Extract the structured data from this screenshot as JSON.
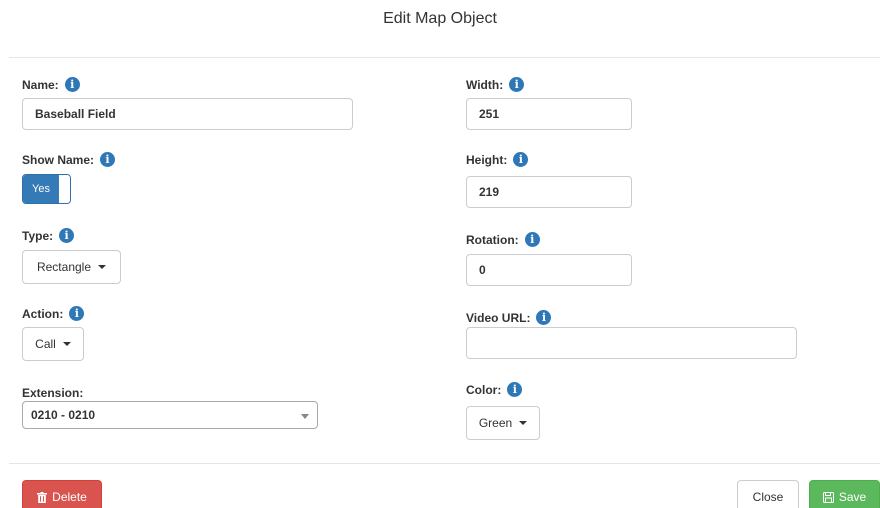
{
  "modal": {
    "title": "Edit Map Object"
  },
  "left": {
    "name": {
      "label": "Name:",
      "value": "Baseball Field"
    },
    "show_name": {
      "label": "Show Name:",
      "toggle_label": "Yes",
      "state": true
    },
    "type": {
      "label": "Type:",
      "value": "Rectangle"
    },
    "action": {
      "label": "Action:",
      "value": "Call"
    },
    "extension": {
      "label": "Extension:",
      "value": "0210 - 0210"
    }
  },
  "right": {
    "width": {
      "label": "Width:",
      "value": "251"
    },
    "height": {
      "label": "Height:",
      "value": "219"
    },
    "rotation": {
      "label": "Rotation:",
      "value": "0"
    },
    "video_url": {
      "label": "Video URL:",
      "value": ""
    },
    "color": {
      "label": "Color:",
      "value": "Green"
    }
  },
  "footer": {
    "delete_label": "Delete",
    "close_label": "Close",
    "save_label": "Save"
  },
  "icons": {
    "info": "info-circle-icon",
    "trash": "trash-icon",
    "save": "floppy-disk-icon"
  },
  "colors": {
    "primary": "#337ab7",
    "danger": "#d9534f",
    "success": "#5cb85c",
    "info_icon": "#2f78b7"
  }
}
